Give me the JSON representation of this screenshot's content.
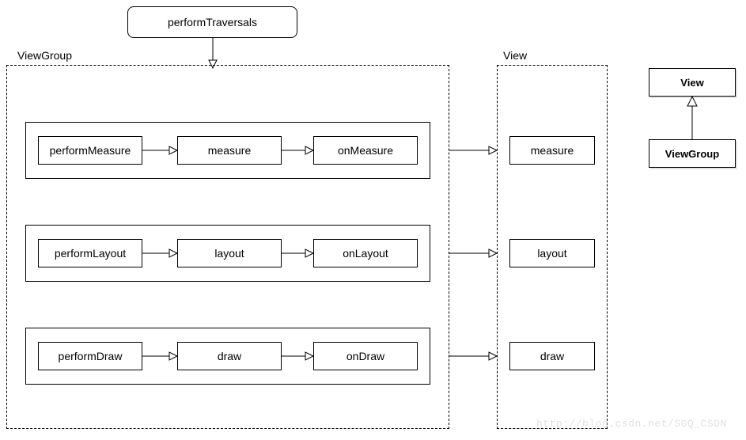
{
  "top": {
    "performTraversals": "performTraversals"
  },
  "groupLabels": {
    "viewGroup": "ViewGroup",
    "view": "View"
  },
  "rows": [
    {
      "perform": "performMeasure",
      "mid": "measure",
      "on": "onMeasure",
      "right": "measure"
    },
    {
      "perform": "performLayout",
      "mid": "layout",
      "on": "onLayout",
      "right": "layout"
    },
    {
      "perform": "performDraw",
      "mid": "draw",
      "on": "onDraw",
      "right": "draw"
    }
  ],
  "classDiagram": {
    "parent": "View",
    "child": "ViewGroup"
  },
  "watermark": "http://blog.csdn.net/SGQ_CSDN"
}
